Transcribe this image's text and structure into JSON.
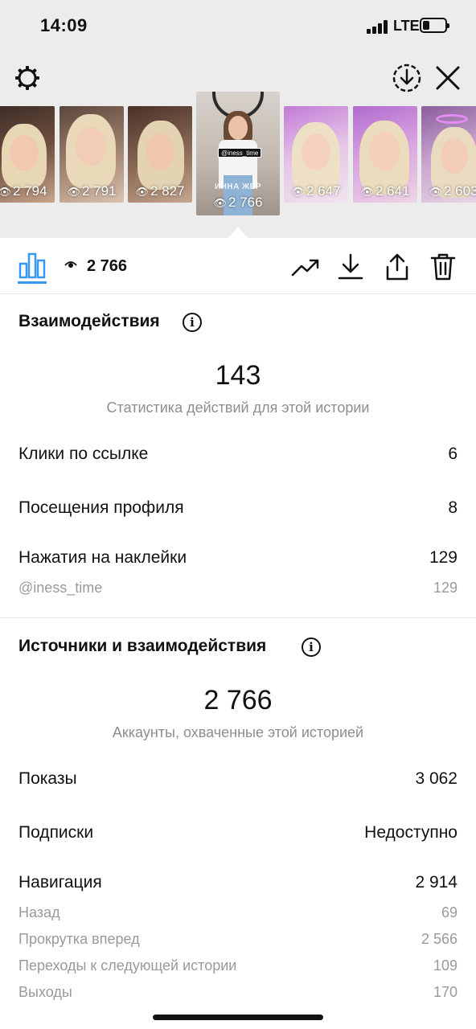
{
  "status_bar": {
    "time": "14:09",
    "network": "LTE"
  },
  "stories": [
    {
      "views": "2 794",
      "selected": false
    },
    {
      "views": "2 791",
      "selected": false
    },
    {
      "views": "2 827",
      "selected": false
    },
    {
      "views": "2 766",
      "selected": true,
      "name": "ИННА ЖЕР",
      "tag": "@iness_time"
    },
    {
      "views": "2 647",
      "selected": false
    },
    {
      "views": "2 641",
      "selected": false
    },
    {
      "views": "2 603",
      "selected": false
    }
  ],
  "toolbar": {
    "views": "2 766"
  },
  "interactions": {
    "title": "Взаимодействия",
    "total": "143",
    "subtitle": "Статистика действий для этой истории",
    "rows": [
      {
        "label": "Клики по ссылке",
        "value": "6"
      },
      {
        "label": "Посещения профиля",
        "value": "8"
      },
      {
        "label": "Нажатия на наклейки",
        "value": "129"
      }
    ],
    "sticker_sub": {
      "label": "@iness_time",
      "value": "129"
    }
  },
  "discovery": {
    "title": "Источники и взаимодействия",
    "total": "2 766",
    "subtitle": "Аккаунты, охваченные этой историей",
    "rows": [
      {
        "label": "Показы",
        "value": "3 062"
      },
      {
        "label": "Подписки",
        "value": "Недоступно"
      },
      {
        "label": "Навигация",
        "value": "2 914"
      }
    ],
    "navigation_sub": [
      {
        "label": "Назад",
        "value": "69"
      },
      {
        "label": "Прокрутка вперед",
        "value": "2 566"
      },
      {
        "label": "Переходы к следующей истории",
        "value": "109"
      },
      {
        "label": "Выходы",
        "value": "170"
      }
    ]
  },
  "colors": {
    "accent": "#3897f0",
    "muted": "#8e8e8e"
  },
  "icons": [
    "gear-icon",
    "download-circle-icon",
    "close-icon",
    "bar-chart-icon",
    "eye-icon",
    "trend-icon",
    "download-icon",
    "share-icon",
    "trash-icon",
    "info-icon"
  ]
}
